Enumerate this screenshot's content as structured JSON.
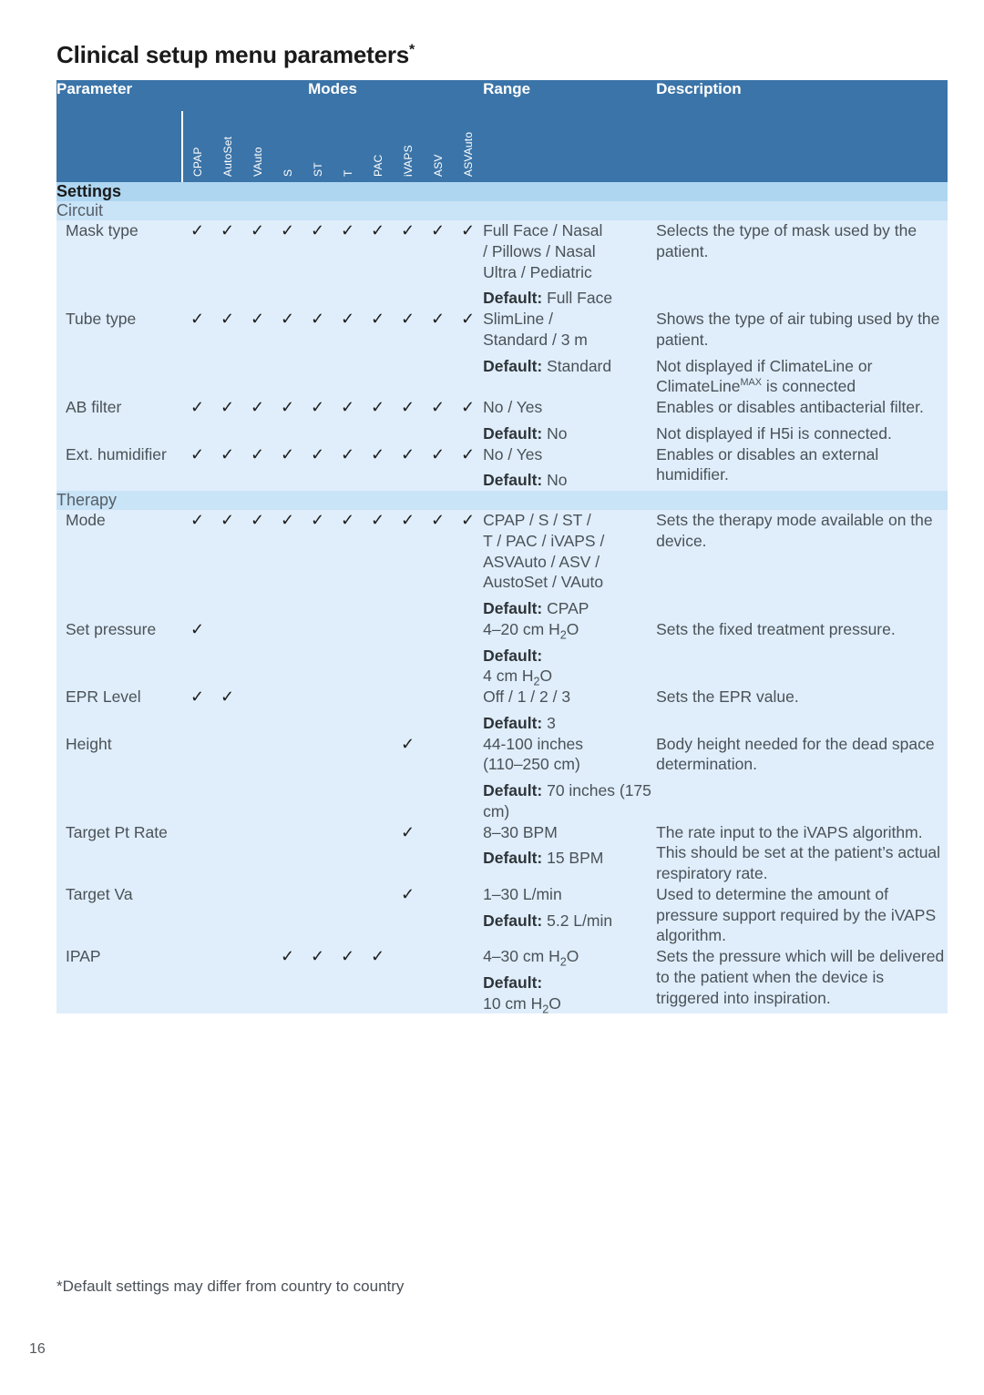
{
  "page": {
    "title": "Clinical setup menu parameters",
    "title_marker": "*",
    "footnote": "*Default settings may differ from country to country",
    "page_number": "16"
  },
  "colors": {
    "header_blue": "#3b74a8",
    "section_band": "#aed6f1",
    "subsection_band": "#c9e3f7",
    "row_fill": "#e0eefb",
    "grid_white": "#ffffff"
  },
  "table": {
    "headers": {
      "parameter": "Parameter",
      "modes": "Modes",
      "range": "Range",
      "description": "Description"
    },
    "mode_columns": [
      "CPAP",
      "AutoSet",
      "VAuto",
      "S",
      "ST",
      "T",
      "PAC",
      "iVAPS",
      "ASV",
      "ASVAuto"
    ],
    "check_glyph": "✓",
    "sections": [
      {
        "label": "Settings",
        "subsections": [
          {
            "label": "Circuit",
            "rows": [
              {
                "parameter": "Mask type",
                "modes": [
                  true,
                  true,
                  true,
                  true,
                  true,
                  true,
                  true,
                  true,
                  true,
                  true
                ],
                "range": [
                  "Full Face / Nasal",
                  "/ Pillows / Nasal",
                  "Ultra / Pediatric"
                ],
                "range_default_label": "Default:",
                "range_default_value": " Full Face",
                "description": [
                  "Selects the type of mask used",
                  "by the patient."
                ]
              },
              {
                "parameter": "Tube type",
                "modes": [
                  true,
                  true,
                  true,
                  true,
                  true,
                  true,
                  true,
                  true,
                  true,
                  true
                ],
                "range": [
                  "SlimLine /",
                  "Standard / 3 m"
                ],
                "range_default_label": "Default:",
                "range_default_value": " Standard",
                "description": [
                  "Shows the type of air tubing",
                  "used by the patient."
                ],
                "description_extra_pre": "Not displayed if ClimateLine or ClimateLine",
                "description_extra_sup": "MAX",
                "description_extra_post": " is connected"
              },
              {
                "parameter": "AB filter",
                "modes": [
                  true,
                  true,
                  true,
                  true,
                  true,
                  true,
                  true,
                  true,
                  true,
                  true
                ],
                "range": [
                  "No / Yes"
                ],
                "range_default_label": "Default:",
                "range_default_value": " No",
                "description": [
                  "Enables or disables antibacterial",
                  "filter."
                ],
                "description_extra": "Not displayed if H5i is connected."
              },
              {
                "parameter": "Ext. humidifier",
                "modes": [
                  true,
                  true,
                  true,
                  true,
                  true,
                  true,
                  true,
                  true,
                  true,
                  true
                ],
                "range": [
                  "No / Yes"
                ],
                "range_default_label": "Default:",
                "range_default_value": " No",
                "description": [
                  "Enables or disables an external",
                  "humidifier."
                ]
              }
            ]
          },
          {
            "label": "Therapy",
            "rows": [
              {
                "parameter": "Mode",
                "modes": [
                  true,
                  true,
                  true,
                  true,
                  true,
                  true,
                  true,
                  true,
                  true,
                  true
                ],
                "range": [
                  "CPAP / S / ST /",
                  "T / PAC / iVAPS /",
                  "ASVAuto / ASV /",
                  "AustoSet / VAuto"
                ],
                "range_default_label": "Default:",
                "range_default_value": " CPAP",
                "description": [
                  "Sets the therapy mode available",
                  "on the device."
                ]
              },
              {
                "parameter": "Set pressure",
                "modes": [
                  true,
                  false,
                  false,
                  false,
                  false,
                  false,
                  false,
                  false,
                  false,
                  false
                ],
                "range_pressure": "4–20 cm H2O",
                "range_default_label": "Default:",
                "range_default_value_pressure": "4 cm H2O",
                "description": [
                  "Sets the fixed treatment",
                  "pressure."
                ]
              },
              {
                "parameter": "EPR Level",
                "modes": [
                  true,
                  true,
                  false,
                  false,
                  false,
                  false,
                  false,
                  false,
                  false,
                  false
                ],
                "range": [
                  "Off / 1 / 2 / 3"
                ],
                "range_default_label": "Default:",
                "range_default_value": " 3",
                "description": [
                  "Sets the EPR value."
                ]
              },
              {
                "parameter": "Height",
                "modes": [
                  false,
                  false,
                  false,
                  false,
                  false,
                  false,
                  false,
                  true,
                  false,
                  false
                ],
                "range": [
                  "44-100 inches",
                  "(110–250 cm)"
                ],
                "range_default_label": "Default:",
                "range_default_value": " 70 inches (175 cm)",
                "description": [
                  "Body height needed for the",
                  "dead space determination."
                ]
              },
              {
                "parameter": "Target Pt Rate",
                "modes": [
                  false,
                  false,
                  false,
                  false,
                  false,
                  false,
                  false,
                  true,
                  false,
                  false
                ],
                "range": [
                  "8–30 BPM"
                ],
                "range_default_label": "Default:",
                "range_default_value": "  15 BPM",
                "description": [
                  "The rate input to the iVAPS",
                  "algorithm. This should be set at",
                  "the patient’s actual respiratory",
                  "rate."
                ]
              },
              {
                "parameter": "Target Va",
                "modes": [
                  false,
                  false,
                  false,
                  false,
                  false,
                  false,
                  false,
                  true,
                  false,
                  false
                ],
                "range": [
                  "1–30 L/min"
                ],
                "range_default_label": "Default:",
                "range_default_value": "  5.2 L/min",
                "description": [
                  "Used to determine the amount",
                  "of pressure support required by",
                  "the iVAPS algorithm."
                ]
              },
              {
                "parameter": "IPAP",
                "modes": [
                  false,
                  false,
                  false,
                  true,
                  true,
                  true,
                  true,
                  false,
                  false,
                  false
                ],
                "range_pressure": "4–30 cm H2O",
                "range_default_label": "Default:",
                "range_default_value_pressure": "10 cm H2O",
                "description": [
                  "Sets the pressure which will be",
                  "delivered to the patient when",
                  "the device is triggered into",
                  "inspiration."
                ]
              }
            ]
          }
        ]
      }
    ]
  }
}
